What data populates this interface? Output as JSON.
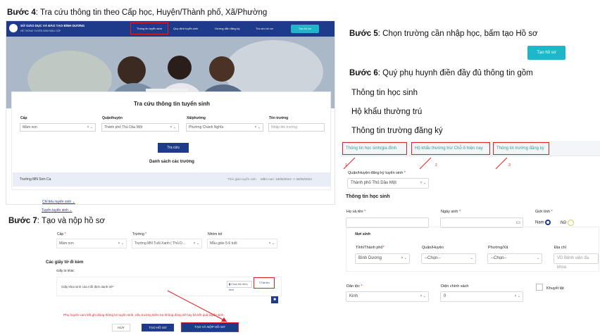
{
  "steps": {
    "s4": {
      "num": "Bước 4",
      "text": ": Tra cứu thông tin theo Cấp học, Huyện/Thành phố, Xã/Phường"
    },
    "s5": {
      "num": "Bước 5",
      "text": ": Chọn trường cần nhập học, bấm tạo Hồ sơ"
    },
    "s6": {
      "num": "Bước 6",
      "text": ": Quý phụ huynh điền đầy đủ thông tin gồm"
    },
    "s6_items": [
      "Thông tin học sinh",
      "Hộ khẩu thường trú",
      "Thông tin trường đăng ký"
    ],
    "s7": {
      "num": "Bước 7",
      "text": ": Tạo và nộp hồ sơ"
    }
  },
  "colors": {
    "navy": "#1e3a8a",
    "teal": "#2aa38f",
    "red": "#e02020",
    "cyan": "#1fb6c9"
  },
  "step5_button": "Tạo hồ sơ",
  "portal": {
    "header": {
      "title": "SỞ GIÁO DỤC VÀ ĐÀO TẠO BÌNH DƯƠNG",
      "subtitle": "HỆ THỐNG TUYỂN SINH ĐẦU CẤP",
      "nav": [
        "Thông tin tuyển sinh",
        "Quy định tuyển sinh",
        "Hướng dẫn đăng ký",
        "Tra cứu hồ sơ"
      ],
      "cta": "Tạo hồ sơ"
    },
    "search": {
      "title": "Tra cứu thông tin tuyển sinh",
      "labels": {
        "level": "Cấp",
        "district": "Quận/huyện",
        "ward": "Xã/phường",
        "school": "Tên trường"
      },
      "values": {
        "level": "Mầm non",
        "district": "Thành phố Thủ Dầu Một",
        "ward": "Phường Chánh Nghĩa"
      },
      "school_placeholder": "Nhập tên trường",
      "search_btn": "Tra cứu",
      "list_title": "Danh sách các trường",
      "row": {
        "name": "Trường MN Sơn Ca",
        "time_label": "Thời gian tuyển sinh",
        "time_value": "Mầm non: 18/05/2024 -> 30/05/2024"
      },
      "links": [
        "Chỉ tiêu tuyển sinh",
        "Tuyến tuyển sinh"
      ]
    }
  },
  "submit": {
    "labels": {
      "level": "Cấp",
      "school": "Trường",
      "group": "Nhóm trẻ"
    },
    "values": {
      "level": "Mầm non",
      "school": "Trường MN Tuổi Xanh ( Thủ D...",
      "group": "Mẫu giáo 5-6 tuổi"
    },
    "docs_title": "Các giấy tờ đi kèm",
    "doc_col": "Giấy tờ khác",
    "doc_item": "Giấy khai sinh của mỗi định danh trẻ*",
    "select_file": "Chọn file đính kèm",
    "upload": "Tải lên",
    "warning": "Phụ huynh cam kết ghi đúng thông tin tuyển sinh, nếu trường kiểm tra không đúng sẽ hủy bỏ kết quả tuyển sinh.",
    "buttons": {
      "cancel": "HỦY",
      "create": "TẠO HỒ SƠ",
      "create_submit": "TẠO VÀ NỘP HỒ SƠ"
    }
  },
  "form": {
    "tabs": [
      "Thông tin học sinh/gia đình",
      "Hộ khẩu thường trú/ Chỗ ở hiện nay",
      "Thông tin trường đăng ký"
    ],
    "tab_nums": [
      "1",
      "2",
      "3"
    ],
    "district_label": "Quận/Huyện đăng ký tuyển sinh",
    "district_value": "Thành phố Thủ Dầu Một",
    "section": "Thông tin học sinh",
    "name_label": "Họ và tên",
    "dob_label": "Ngày sinh",
    "gender_label": "Giới tính",
    "gender_options": [
      "Nam",
      "Nữ"
    ],
    "birth_section": "Nơi sinh",
    "province_label": "Tỉnh/Thành phố",
    "province_value": "Bình Dương",
    "dist2_label": "Quận/Huyện",
    "dist2_value": "--Chọn--",
    "ward_label": "Phường/Xã",
    "ward_value": "--Chọn--",
    "address_label": "Địa chỉ",
    "address_value": "VD Bệnh viện đa khoa",
    "ethnic_label": "Dân tộc",
    "ethnic_value": "Kinh",
    "policy_label": "Diện chính sách",
    "policy_value": "0",
    "disability_label": "Khuyết tật"
  }
}
